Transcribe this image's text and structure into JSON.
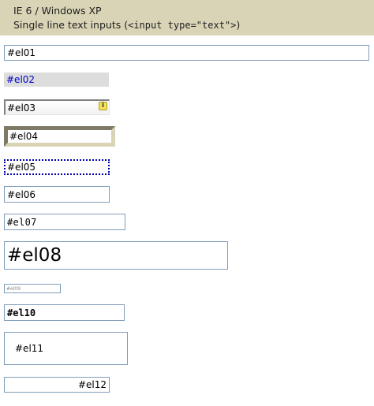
{
  "header": {
    "title": "IE 6 / Windows XP",
    "subtitle_prefix": "Single line text inputs (",
    "subtitle_code": "<input type=\"text\">",
    "subtitle_suffix": ")"
  },
  "inputs": [
    {
      "id": "el01",
      "value": "#el01"
    },
    {
      "id": "el02",
      "value": "#el02"
    },
    {
      "id": "el03",
      "value": "#el03"
    },
    {
      "id": "el04",
      "value": "#el04"
    },
    {
      "id": "el05",
      "value": "#el05"
    },
    {
      "id": "el06",
      "value": "#el06"
    },
    {
      "id": "el07",
      "value": "#el07"
    },
    {
      "id": "el08",
      "value": "#el08"
    },
    {
      "id": "el09",
      "value": "#el09"
    },
    {
      "id": "el10",
      "value": "#el10"
    },
    {
      "id": "el11",
      "value": "#el11"
    },
    {
      "id": "el12",
      "value": "#el12"
    }
  ],
  "icons": {
    "el03_icon": "info-icon",
    "el03_icon_glyph": "i"
  },
  "colors": {
    "header_bg": "#d9d4b6",
    "input_border": "#7f9db9",
    "el02_bg": "#dddddd",
    "el02_text": "#0000cc",
    "el05_border": "#0000aa"
  }
}
